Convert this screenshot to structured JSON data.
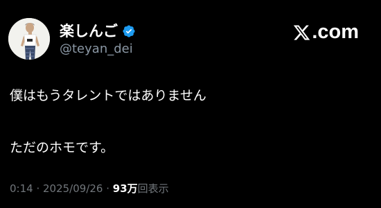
{
  "author": {
    "display_name": "楽しんご",
    "handle": "@teyan_dei",
    "verified_icon": "verified-badge-icon",
    "avatar_icon": "profile-avatar"
  },
  "site": {
    "logo_icon": "x-logo-icon",
    "label": ".com"
  },
  "tweet": {
    "lines": [
      "僕はもうタレントではありません",
      "ただのホモです。"
    ]
  },
  "meta": {
    "time": "0:14",
    "sep1": " · ",
    "date": "2025/09/26",
    "sep2": " · ",
    "views_count": "93万",
    "views_label": "回表示"
  },
  "colors": {
    "background": "#000000",
    "primary_text": "#ffffff",
    "secondary_text": "#71767b",
    "verified": "#1d9bf0"
  }
}
